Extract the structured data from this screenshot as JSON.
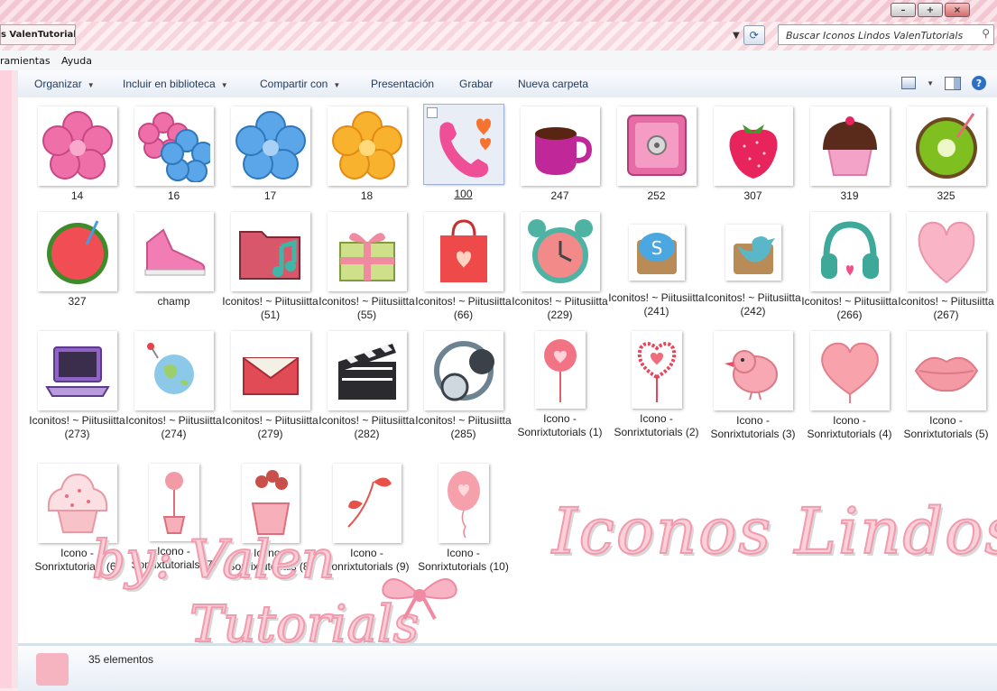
{
  "window": {
    "min_label": "–",
    "max_label": "+",
    "close_label": "×"
  },
  "address": {
    "crumb": "s ValenTutorials",
    "search_placeholder": "Buscar Iconos Lindos ValenTutorials"
  },
  "menu": {
    "items": [
      "ramientas",
      "Ayuda"
    ]
  },
  "toolbar": {
    "buttons": [
      "Organizar",
      "Incluir en biblioteca",
      "Compartir con",
      "Presentación",
      "Grabar",
      "Nueva carpeta"
    ]
  },
  "colors": {
    "accent": "#f29aae",
    "selection": "#e9eef6"
  },
  "items": [
    {
      "label": "14",
      "icon": "pink-flower-icon"
    },
    {
      "label": "16",
      "icon": "pink-blue-flowers-icon"
    },
    {
      "label": "17",
      "icon": "blue-flower-icon"
    },
    {
      "label": "18",
      "icon": "orange-flower-icon"
    },
    {
      "label": "100",
      "icon": "phone-hearts-icon"
    },
    {
      "label": "247",
      "icon": "cup-icon"
    },
    {
      "label": "252",
      "icon": "safe-icon"
    },
    {
      "label": "307",
      "icon": "strawberry-icon"
    },
    {
      "label": "319",
      "icon": "cupcake-icon"
    },
    {
      "label": "325",
      "icon": "kiwi-icon"
    },
    {
      "label": "327",
      "icon": "watermelon-icon"
    },
    {
      "label": "champ",
      "icon": "sneaker-icon"
    },
    {
      "label": "Iconitos! ~ Piitusiitta (51)",
      "icon": "music-folder-icon"
    },
    {
      "label": "Iconitos! ~ Piitusiitta (55)",
      "icon": "gift-icon"
    },
    {
      "label": "Iconitos! ~ Piitusiitta (66)",
      "icon": "shopping-bag-icon"
    },
    {
      "label": "Iconitos! ~ Piitusiitta (229)",
      "icon": "alarm-clock-icon"
    },
    {
      "label": "Iconitos! ~ Piitusiitta (241)",
      "icon": "skype-icon"
    },
    {
      "label": "Iconitos! ~ Piitusiitta (242)",
      "icon": "twitter-icon"
    },
    {
      "label": "Iconitos! ~ Piitusiitta (266)",
      "icon": "headphones-icon"
    },
    {
      "label": "Iconitos! ~ Piitusiitta (267)",
      "icon": "heart-icon"
    },
    {
      "label": "Iconitos! ~ Piitusiitta (273)",
      "icon": "laptop-icon"
    },
    {
      "label": "Iconitos! ~ Piitusiitta (274)",
      "icon": "globe-icon"
    },
    {
      "label": "Iconitos! ~ Piitusiitta (279)",
      "icon": "envelope-icon"
    },
    {
      "label": "Iconitos! ~ Piitusiitta (282)",
      "icon": "clapperboard-icon"
    },
    {
      "label": "Iconitos! ~ Piitusiitta (285)",
      "icon": "headphones-dark-icon"
    },
    {
      "label": "Icono - Sonrixtutorials (1)",
      "icon": "heart-lollipop-icon"
    },
    {
      "label": "Icono - Sonrixtutorials (2)",
      "icon": "heart-flower-icon"
    },
    {
      "label": "Icono - Sonrixtutorials (3)",
      "icon": "bird-icon"
    },
    {
      "label": "Icono - Sonrixtutorials (4)",
      "icon": "heart-balloon-icon"
    },
    {
      "label": "Icono - Sonrixtutorials (5)",
      "icon": "lips-icon"
    },
    {
      "label": "Icono - Sonrixtutorials (6)",
      "icon": "cupcake-pink-icon"
    },
    {
      "label": "Icono - Sonrixtutorials (7)",
      "icon": "flower-pot-icon"
    },
    {
      "label": "Icono - Sonrixtutorials (8)",
      "icon": "lollipop-pot-icon"
    },
    {
      "label": "Icono - Sonrixtutorials (9)",
      "icon": "heart-branch-icon"
    },
    {
      "label": "Icono - Sonrixtutorials (10)",
      "icon": "balloon-icon"
    }
  ],
  "status": {
    "text": "35 elementos"
  },
  "watermark": {
    "line1": "Iconos Lindos",
    "line2": "by: Valen",
    "line3": "Tutorials"
  }
}
